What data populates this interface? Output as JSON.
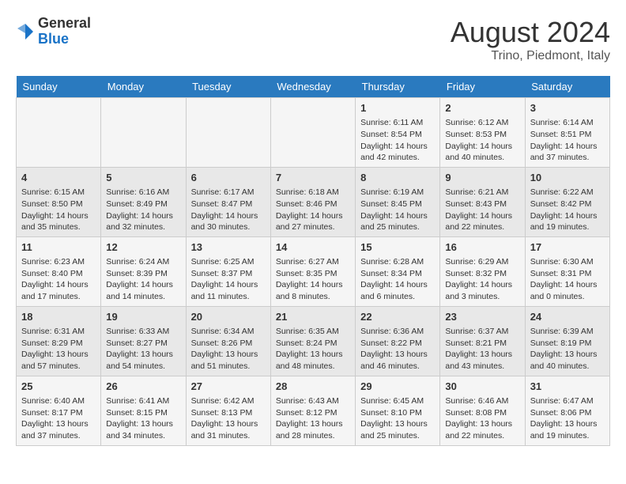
{
  "logo": {
    "general": "General",
    "blue": "Blue"
  },
  "header": {
    "month_year": "August 2024",
    "location": "Trino, Piedmont, Italy"
  },
  "days_of_week": [
    "Sunday",
    "Monday",
    "Tuesday",
    "Wednesday",
    "Thursday",
    "Friday",
    "Saturday"
  ],
  "weeks": [
    [
      {
        "day": "",
        "info": ""
      },
      {
        "day": "",
        "info": ""
      },
      {
        "day": "",
        "info": ""
      },
      {
        "day": "",
        "info": ""
      },
      {
        "day": "1",
        "info": "Sunrise: 6:11 AM\nSunset: 8:54 PM\nDaylight: 14 hours and 42 minutes."
      },
      {
        "day": "2",
        "info": "Sunrise: 6:12 AM\nSunset: 8:53 PM\nDaylight: 14 hours and 40 minutes."
      },
      {
        "day": "3",
        "info": "Sunrise: 6:14 AM\nSunset: 8:51 PM\nDaylight: 14 hours and 37 minutes."
      }
    ],
    [
      {
        "day": "4",
        "info": "Sunrise: 6:15 AM\nSunset: 8:50 PM\nDaylight: 14 hours and 35 minutes."
      },
      {
        "day": "5",
        "info": "Sunrise: 6:16 AM\nSunset: 8:49 PM\nDaylight: 14 hours and 32 minutes."
      },
      {
        "day": "6",
        "info": "Sunrise: 6:17 AM\nSunset: 8:47 PM\nDaylight: 14 hours and 30 minutes."
      },
      {
        "day": "7",
        "info": "Sunrise: 6:18 AM\nSunset: 8:46 PM\nDaylight: 14 hours and 27 minutes."
      },
      {
        "day": "8",
        "info": "Sunrise: 6:19 AM\nSunset: 8:45 PM\nDaylight: 14 hours and 25 minutes."
      },
      {
        "day": "9",
        "info": "Sunrise: 6:21 AM\nSunset: 8:43 PM\nDaylight: 14 hours and 22 minutes."
      },
      {
        "day": "10",
        "info": "Sunrise: 6:22 AM\nSunset: 8:42 PM\nDaylight: 14 hours and 19 minutes."
      }
    ],
    [
      {
        "day": "11",
        "info": "Sunrise: 6:23 AM\nSunset: 8:40 PM\nDaylight: 14 hours and 17 minutes."
      },
      {
        "day": "12",
        "info": "Sunrise: 6:24 AM\nSunset: 8:39 PM\nDaylight: 14 hours and 14 minutes."
      },
      {
        "day": "13",
        "info": "Sunrise: 6:25 AM\nSunset: 8:37 PM\nDaylight: 14 hours and 11 minutes."
      },
      {
        "day": "14",
        "info": "Sunrise: 6:27 AM\nSunset: 8:35 PM\nDaylight: 14 hours and 8 minutes."
      },
      {
        "day": "15",
        "info": "Sunrise: 6:28 AM\nSunset: 8:34 PM\nDaylight: 14 hours and 6 minutes."
      },
      {
        "day": "16",
        "info": "Sunrise: 6:29 AM\nSunset: 8:32 PM\nDaylight: 14 hours and 3 minutes."
      },
      {
        "day": "17",
        "info": "Sunrise: 6:30 AM\nSunset: 8:31 PM\nDaylight: 14 hours and 0 minutes."
      }
    ],
    [
      {
        "day": "18",
        "info": "Sunrise: 6:31 AM\nSunset: 8:29 PM\nDaylight: 13 hours and 57 minutes."
      },
      {
        "day": "19",
        "info": "Sunrise: 6:33 AM\nSunset: 8:27 PM\nDaylight: 13 hours and 54 minutes."
      },
      {
        "day": "20",
        "info": "Sunrise: 6:34 AM\nSunset: 8:26 PM\nDaylight: 13 hours and 51 minutes."
      },
      {
        "day": "21",
        "info": "Sunrise: 6:35 AM\nSunset: 8:24 PM\nDaylight: 13 hours and 48 minutes."
      },
      {
        "day": "22",
        "info": "Sunrise: 6:36 AM\nSunset: 8:22 PM\nDaylight: 13 hours and 46 minutes."
      },
      {
        "day": "23",
        "info": "Sunrise: 6:37 AM\nSunset: 8:21 PM\nDaylight: 13 hours and 43 minutes."
      },
      {
        "day": "24",
        "info": "Sunrise: 6:39 AM\nSunset: 8:19 PM\nDaylight: 13 hours and 40 minutes."
      }
    ],
    [
      {
        "day": "25",
        "info": "Sunrise: 6:40 AM\nSunset: 8:17 PM\nDaylight: 13 hours and 37 minutes."
      },
      {
        "day": "26",
        "info": "Sunrise: 6:41 AM\nSunset: 8:15 PM\nDaylight: 13 hours and 34 minutes."
      },
      {
        "day": "27",
        "info": "Sunrise: 6:42 AM\nSunset: 8:13 PM\nDaylight: 13 hours and 31 minutes."
      },
      {
        "day": "28",
        "info": "Sunrise: 6:43 AM\nSunset: 8:12 PM\nDaylight: 13 hours and 28 minutes."
      },
      {
        "day": "29",
        "info": "Sunrise: 6:45 AM\nSunset: 8:10 PM\nDaylight: 13 hours and 25 minutes."
      },
      {
        "day": "30",
        "info": "Sunrise: 6:46 AM\nSunset: 8:08 PM\nDaylight: 13 hours and 22 minutes."
      },
      {
        "day": "31",
        "info": "Sunrise: 6:47 AM\nSunset: 8:06 PM\nDaylight: 13 hours and 19 minutes."
      }
    ]
  ]
}
